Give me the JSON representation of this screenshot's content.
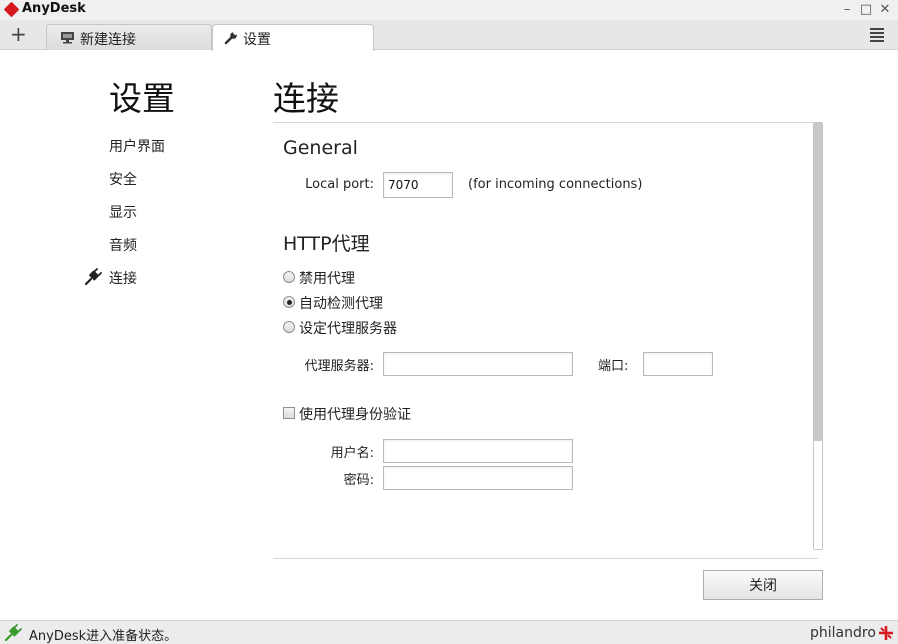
{
  "window": {
    "title": "AnyDesk",
    "minimize_glyph": "–",
    "maximize_glyph": "□",
    "close_glyph": "✕"
  },
  "tabs": {
    "new_tab_glyph": "+",
    "items": [
      {
        "label": "新建连接",
        "icon": "monitor-icon",
        "active": false
      },
      {
        "label": "设置",
        "icon": "wrench-icon",
        "active": true
      }
    ],
    "menu_icon": "hamburger-menu-icon"
  },
  "sidebar": {
    "title": "设置",
    "items": [
      {
        "label": "用户界面"
      },
      {
        "label": "安全"
      },
      {
        "label": "显示"
      },
      {
        "label": "音频"
      },
      {
        "label": "连接",
        "active": true
      }
    ]
  },
  "main": {
    "title": "连接",
    "general": {
      "title": "General",
      "local_port_label": "Local port:",
      "local_port_value": "7070",
      "local_port_hint": "(for incoming connections)"
    },
    "proxy": {
      "title": "HTTP代理",
      "options": [
        {
          "label": "禁用代理",
          "selected": false
        },
        {
          "label": "自动检测代理",
          "selected": true
        },
        {
          "label": "设定代理服务器",
          "selected": false
        }
      ],
      "server_label": "代理服务器:",
      "server_value": "",
      "port_label": "端口:",
      "port_value": "",
      "auth_checkbox_label": "使用代理身份验证",
      "auth_checked": false,
      "username_label": "用户名:",
      "username_value": "",
      "password_label": "密码:",
      "password_value": ""
    },
    "close_button": "关闭"
  },
  "statusbar": {
    "text": "AnyDesk进入准备状态。",
    "brand": "philandro"
  },
  "colors": {
    "brand_red": "#d71920",
    "status_green": "#3a9a2e"
  }
}
